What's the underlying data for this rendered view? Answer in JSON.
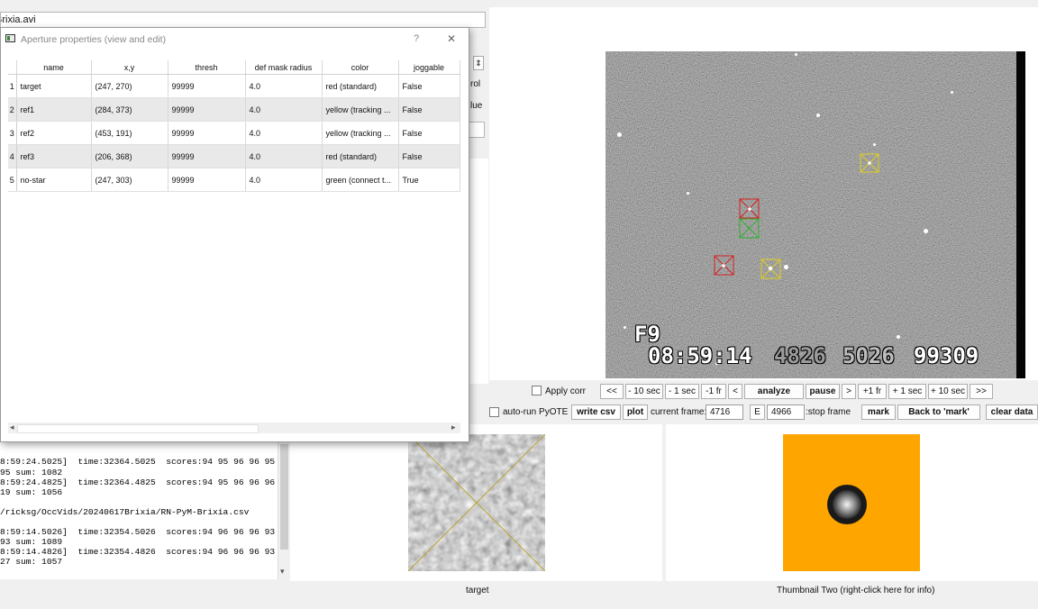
{
  "main_window": {
    "file_path": "Brixia.avi",
    "partial_label_1": "rol",
    "partial_label_2": "lue"
  },
  "dialog": {
    "title": "Aperture properties (view and edit)",
    "help_glyph": "?",
    "close_glyph": "✕",
    "columns": [
      "name",
      "x,y",
      "thresh",
      "def mask radius",
      "color",
      "joggable"
    ],
    "rows": [
      {
        "num": "1",
        "name": "target",
        "xy": "(247, 270)",
        "thresh": "99999",
        "radius": "4.0",
        "color": "red (standard)",
        "joggable": "False"
      },
      {
        "num": "2",
        "name": "ref1",
        "xy": "(284, 373)",
        "thresh": "99999",
        "radius": "4.0",
        "color": "yellow (tracking ...",
        "joggable": "False"
      },
      {
        "num": "3",
        "name": "ref2",
        "xy": "(453, 191)",
        "thresh": "99999",
        "radius": "4.0",
        "color": "yellow (tracking ...",
        "joggable": "False"
      },
      {
        "num": "4",
        "name": "ref3",
        "xy": "(206, 368)",
        "thresh": "99999",
        "radius": "4.0",
        "color": "red (standard)",
        "joggable": "False"
      },
      {
        "num": "5",
        "name": "no-star",
        "xy": "(247, 303)",
        "thresh": "99999",
        "radius": "4.0",
        "color": "green (connect t...",
        "joggable": "True"
      }
    ]
  },
  "log": {
    "lines": [
      "8:59:24.5025]  time:32364.5025  scores:94 95 96 96 95",
      "95 sum: 1082",
      "8:59:24.4825]  time:32364.4825  scores:94 95 96 96 96",
      "19 sum: 1056",
      "",
      "/ricksg/OccVids/20240617Brixia/RN-PyM-Brixia.csv",
      "",
      "8:59:14.5026]  time:32354.5026  scores:94 96 96 96 93",
      "93 sum: 1089",
      "8:59:14.4826]  time:32354.4826  scores:94 96 96 96 93",
      "27 sum: 1057"
    ]
  },
  "video": {
    "osd_label": "F9",
    "osd_time": "08:59:14",
    "osd_field1": "4826",
    "osd_field2": "5026",
    "osd_count": "99309"
  },
  "controls": {
    "apply_corr": "Apply corr",
    "nav": [
      "<<",
      "- 10 sec",
      "- 1 sec",
      "-1 fr",
      "<",
      "analyze",
      "pause",
      ">",
      "+1 fr",
      "+ 1 sec",
      "+ 10 sec",
      ">>"
    ],
    "auto_run": "auto-run PyOTE",
    "write_csv": "write csv",
    "plot": "plot",
    "current_frame_label": "current frame:",
    "current_frame_value": "4716",
    "e_button": "E",
    "stop_frame_value": "4966",
    "stop_frame_label": ":stop frame",
    "mark": "mark",
    "back_to_mark": "Back to 'mark'",
    "clear_data": "clear data"
  },
  "thumbnails": {
    "one_caption": "target",
    "two_caption": "Thumbnail Two (right-click here for info)",
    "two_background": "#FFA500"
  },
  "colors": {
    "aperture_red": "#d42020",
    "aperture_yellow": "#e0d020",
    "aperture_green": "#2fb02f"
  },
  "icons": {
    "dialog_window_icon": "window-icon",
    "scroll_left": "◂",
    "scroll_right": "▸",
    "scroll_down": "▾",
    "spin_up_down": "⇕"
  }
}
